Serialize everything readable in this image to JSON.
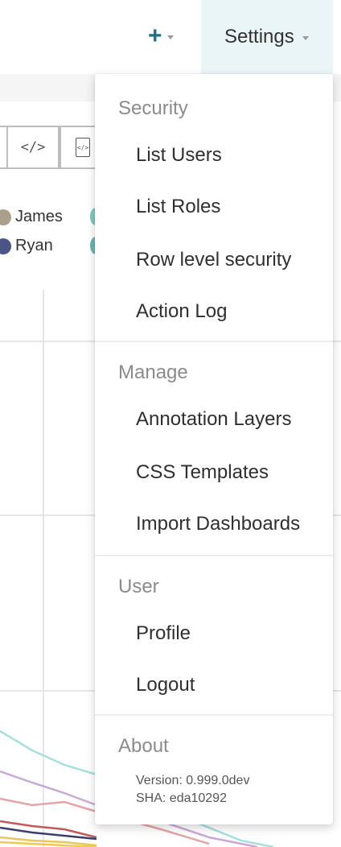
{
  "navbar": {
    "add_icon": "plus-icon",
    "add_glyph": "+",
    "settings_label": "Settings",
    "caret_icon": "caret-down-icon"
  },
  "toolbar": {
    "code_glyph": "</>",
    "export_glyph": "</>",
    "code_icon": "code-icon",
    "export_icon": "file-code-icon"
  },
  "legend": [
    {
      "label": "James",
      "color": "#a99f8a"
    },
    {
      "label": "Ryan",
      "color": "#4a5485"
    }
  ],
  "settings_menu": {
    "sections": [
      {
        "header": "Security",
        "items": [
          "List Users",
          "List Roles",
          "Row level security",
          "Action Log"
        ]
      },
      {
        "header": "Manage",
        "items": [
          "Annotation Layers",
          "CSS Templates",
          "Import Dashboards"
        ]
      },
      {
        "header": "User",
        "items": [
          "Profile",
          "Logout"
        ]
      },
      {
        "header": "About",
        "version": "Version: 0.999.0dev",
        "sha": "SHA: eda10292"
      }
    ]
  },
  "colors": {
    "nav_active_bg": "#e9f5f7",
    "plus_icon": "#1f6f8b",
    "menu_header": "#8b8b8b",
    "menu_item": "#2f2f2f",
    "line_series": [
      "#a6e0de",
      "#c9a9d6",
      "#e5a4a6",
      "#c05a5a",
      "#3c3f6e",
      "#e8c85a",
      "#f2c94c"
    ]
  }
}
